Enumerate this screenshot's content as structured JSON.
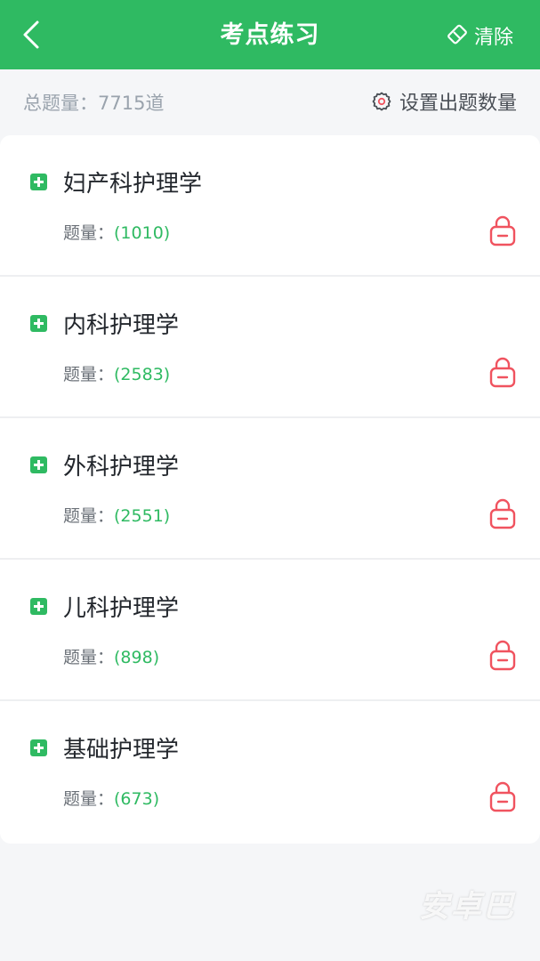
{
  "header": {
    "title": "考点练习",
    "back_icon": "chevron-left-icon",
    "clear_label": "清除",
    "clear_icon": "eraser-icon"
  },
  "summary": {
    "total_label": "总题量：7715道",
    "settings_label": "设置出题数量",
    "settings_icon": "gear-icon"
  },
  "items": [
    {
      "title": "妇产科护理学",
      "count_label": "题量：",
      "count": "(1010)"
    },
    {
      "title": "内科护理学",
      "count_label": "题量：",
      "count": "(2583)"
    },
    {
      "title": "外科护理学",
      "count_label": "题量：",
      "count": "(2551)"
    },
    {
      "title": "儿科护理学",
      "count_label": "题量：",
      "count": "(898)"
    },
    {
      "title": "基础护理学",
      "count_label": "题量：",
      "count": "(673)"
    }
  ],
  "watermark": "安卓巴",
  "colors": {
    "brand_green": "#2fba62",
    "lock_red": "#f0535f",
    "background": "#f5f6f8"
  }
}
